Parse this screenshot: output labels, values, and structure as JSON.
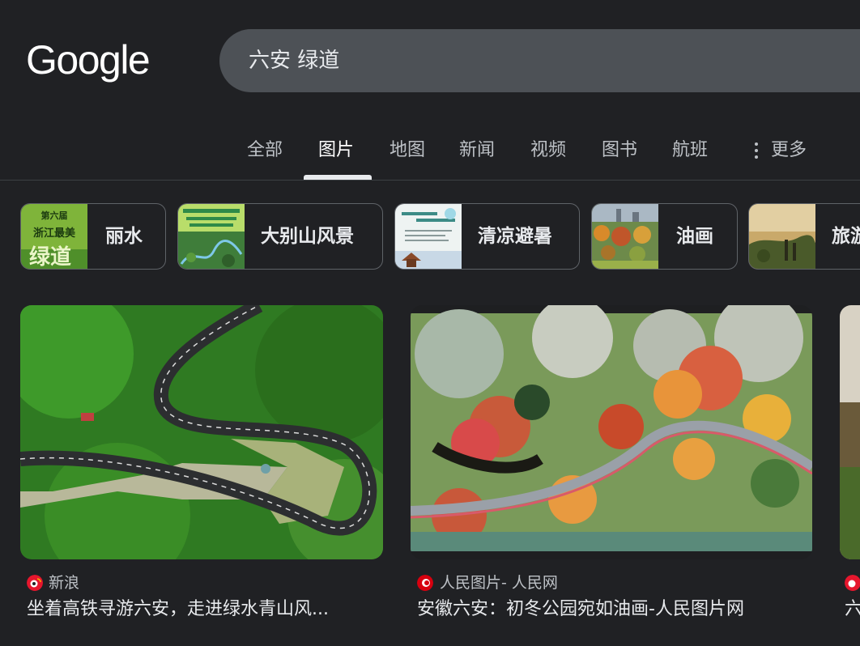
{
  "logo": "Google",
  "search": {
    "query": "六安 绿道"
  },
  "tabs": [
    {
      "label": "全部"
    },
    {
      "label": "图片"
    },
    {
      "label": "地图"
    },
    {
      "label": "新闻"
    },
    {
      "label": "视频"
    },
    {
      "label": "图书"
    },
    {
      "label": "航班"
    },
    {
      "label": "更多"
    }
  ],
  "chips": [
    {
      "label": "丽水",
      "thumb_text": [
        "第六届",
        "浙江最美",
        "绿道"
      ]
    },
    {
      "label": "大别山风景"
    },
    {
      "label": "清凉避暑"
    },
    {
      "label": "油画"
    },
    {
      "label": "旅游"
    }
  ],
  "results": [
    {
      "source": "新浪",
      "title": "坐着高铁寻游六安，走进绿水青山风..."
    },
    {
      "source": "人民图片- 人民网",
      "title": "安徽六安：初冬公园宛如油画-人民图片网"
    },
    {
      "source": "",
      "title": "六"
    }
  ],
  "colors": {
    "background": "#202124",
    "search_box": "#4d5156",
    "sina_icon": "#e6162d",
    "people_icon": "#d7000f"
  }
}
